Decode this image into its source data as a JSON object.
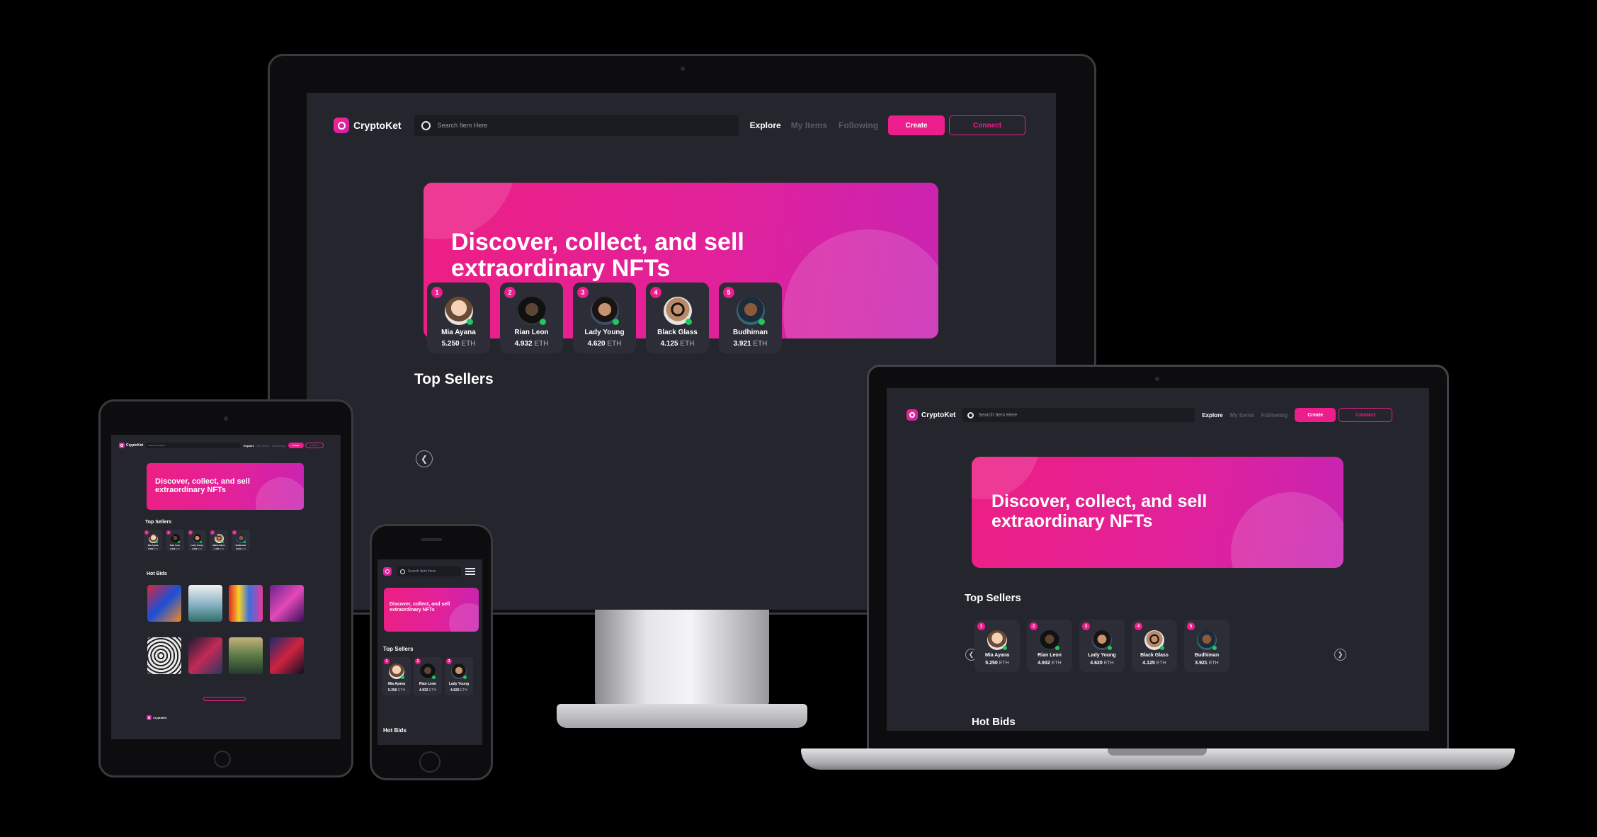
{
  "app": {
    "name": "CryptoKet",
    "search_placeholder": "Search Item Here",
    "menu": [
      "Explore",
      "My Items",
      "Following"
    ],
    "create_label": "Create",
    "connect_label": "Connect",
    "banner_title_line1": "Discover, collect, and sell",
    "banner_title_line2": "extraordinary NFTs",
    "top_sellers_title": "Top Sellers",
    "hot_bids_title": "Hot Bids",
    "unit": "ETH"
  },
  "sellers": [
    {
      "rank": "1",
      "name": "Mia Ayana",
      "value": "5.250"
    },
    {
      "rank": "2",
      "name": "Rian Leon",
      "value": "4.932"
    },
    {
      "rank": "3",
      "name": "Lady Young",
      "value": "4.620"
    },
    {
      "rank": "4",
      "name": "Black Glass",
      "value": "4.125"
    },
    {
      "rank": "5",
      "name": "Budhiman",
      "value": "3.921"
    }
  ],
  "icons": {
    "prev": "chevron-left-icon",
    "next": "chevron-right-icon",
    "menu": "hamburger-menu-icon"
  },
  "colors": {
    "background": "#000000",
    "screen": "#24252d",
    "card": "#2c2d37",
    "accent": "#eb1e8c",
    "online": "#22c55e"
  }
}
